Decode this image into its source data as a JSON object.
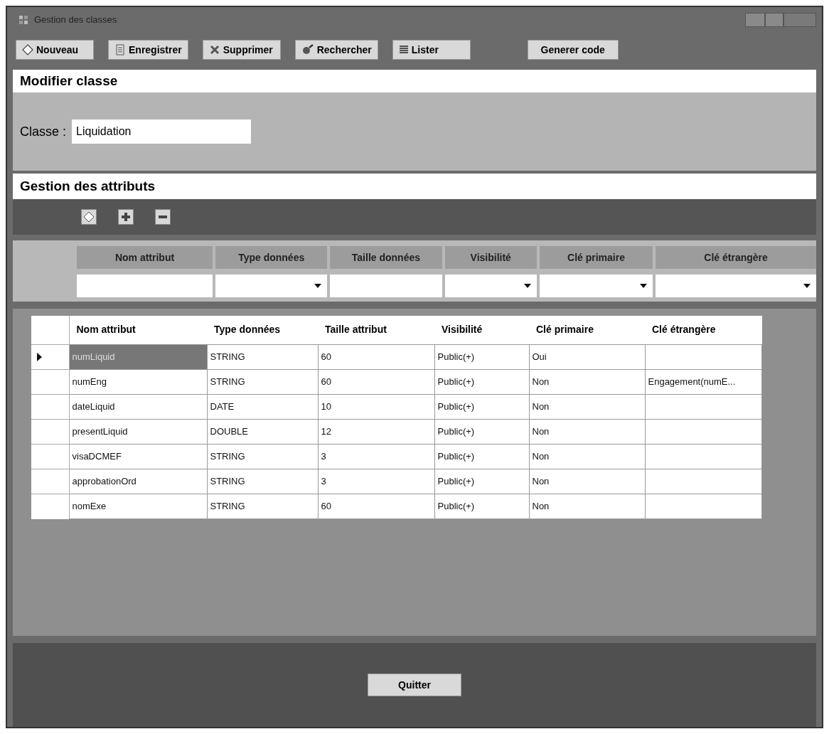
{
  "window": {
    "title": "Gestion des classes"
  },
  "toolbar": [
    {
      "label": "Nouveau",
      "kind": "new"
    },
    {
      "label": "Enregistrer",
      "kind": "save"
    },
    {
      "label": "Supprimer",
      "kind": "delete"
    },
    {
      "label": "Rechercher",
      "kind": "search"
    },
    {
      "label": "Lister",
      "kind": "list"
    },
    {
      "label": "Generer code",
      "kind": "plain"
    }
  ],
  "class_section": {
    "title": "Modifier classe",
    "label": "Classe :",
    "value": "Liquidation"
  },
  "attributes_section": {
    "title": "Gestion des attributs",
    "actions": [
      {
        "kind": "new"
      },
      {
        "kind": "add"
      },
      {
        "kind": "remove"
      }
    ]
  },
  "filters": [
    {
      "label": "Nom attribut",
      "kind": "text"
    },
    {
      "label": "Type données",
      "kind": "select"
    },
    {
      "label": "Taille données",
      "kind": "text"
    },
    {
      "label": "Visibilité",
      "kind": "select"
    },
    {
      "label": "Clé primaire",
      "kind": "select"
    },
    {
      "label": "Clé étrangère",
      "kind": "select"
    }
  ],
  "table": {
    "columns": [
      "Nom attribut",
      "Type données",
      "Taille attribut",
      "Visibilité",
      "Clé primaire",
      "Clé étrangère"
    ],
    "rows": [
      {
        "selected": true,
        "cells": [
          "numLiquid",
          "STRING",
          "60",
          "Public(+)",
          "Oui",
          ""
        ]
      },
      {
        "selected": false,
        "cells": [
          "numEng",
          "STRING",
          "60",
          "Public(+)",
          "Non",
          "Engagement(numE..."
        ]
      },
      {
        "selected": false,
        "cells": [
          "dateLiquid",
          "DATE",
          "10",
          "Public(+)",
          "Non",
          ""
        ]
      },
      {
        "selected": false,
        "cells": [
          "presentLiquid",
          "DOUBLE",
          "12",
          "Public(+)",
          "Non",
          ""
        ]
      },
      {
        "selected": false,
        "cells": [
          "visaDCMEF",
          "STRING",
          "3",
          "Public(+)",
          "Non",
          ""
        ]
      },
      {
        "selected": false,
        "cells": [
          "approbationOrd",
          "STRING",
          "3",
          "Public(+)",
          "Non",
          ""
        ]
      },
      {
        "selected": false,
        "cells": [
          "nomExe",
          "STRING",
          "60",
          "Public(+)",
          "Non",
          ""
        ]
      }
    ]
  },
  "footer": {
    "button": "Quitter"
  }
}
